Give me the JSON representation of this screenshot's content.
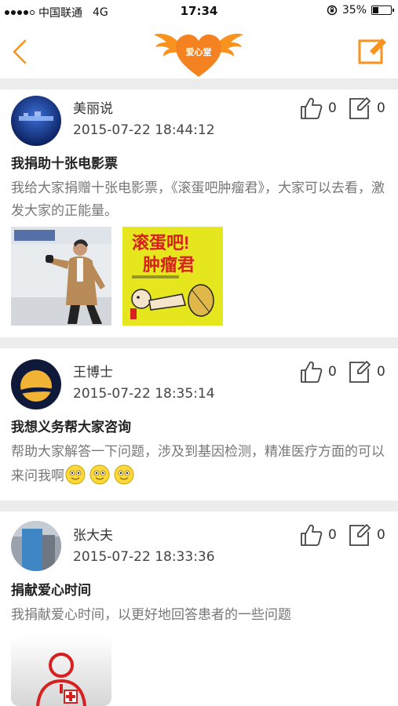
{
  "status_bar": {
    "carrier": "中国联通",
    "network": "4G",
    "time": "17:34",
    "battery": "35%",
    "battery_level": 0.35
  },
  "header": {
    "logo_text": "爱心堂",
    "accent_color": "#f7931e",
    "icons": {
      "back": "chevron-left-icon",
      "edit": "edit-icon"
    }
  },
  "posts": [
    {
      "author": "美丽说",
      "date": "2015-07-22 18:44:12",
      "likes": "0",
      "comments": "0",
      "title": "我捐助十张电影票",
      "body": "我给大家捐赠十张电影票，《滚蛋吧肿瘤君》，大家可以去看，激发大家的正能量。",
      "poster_title_1": "滚蛋吧!",
      "poster_title_2": "肿瘤君"
    },
    {
      "author": "王博士",
      "date": "2015-07-22 18:35:14",
      "likes": "0",
      "comments": "0",
      "title": "我想义务帮大家咨询",
      "body": "帮助大家解答一下问题，涉及到基因检测，精准医疗方面的可以来问我啊"
    },
    {
      "author": "张大夫",
      "date": "2015-07-22 18:33:36",
      "likes": "0",
      "comments": "0",
      "title": "捐献爱心时间",
      "body": "我捐献爱心时间，以更好地回答患者的一些问题"
    }
  ]
}
